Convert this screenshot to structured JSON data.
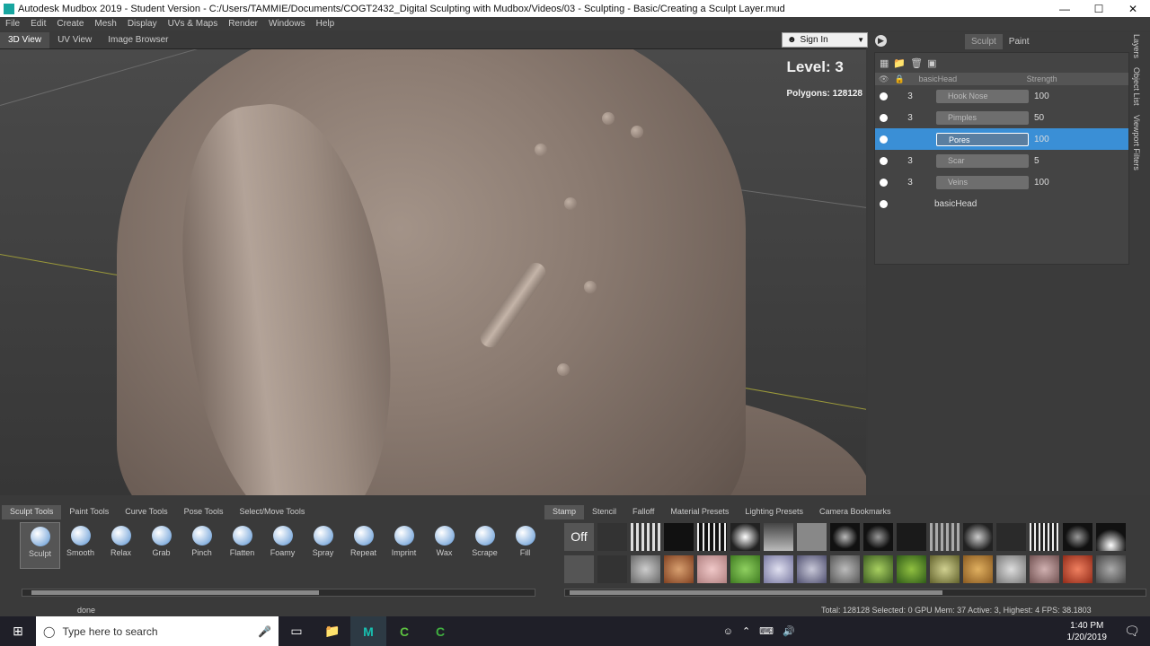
{
  "titlebar": {
    "title": "Autodesk Mudbox 2019 - Student Version - C:/Users/TAMMIE/Documents/COGT2432_Digital Sculpting with Mudbox/Videos/03 - Sculpting - Basic/Creating a Sculpt Layer.mud",
    "minimize": "—",
    "maximize": "☐",
    "close": "✕"
  },
  "menu": [
    "File",
    "Edit",
    "Create",
    "Mesh",
    "Display",
    "UVs & Maps",
    "Render",
    "Windows",
    "Help"
  ],
  "view_tabs": [
    "3D View",
    "UV View",
    "Image Browser"
  ],
  "viewport": {
    "level": "Level: 3",
    "polygons": "Polygons: 128128"
  },
  "signin": {
    "label": "Sign In"
  },
  "mode_tabs": [
    "Sculpt",
    "Paint"
  ],
  "layers": {
    "header_name": "basicHead",
    "header_strength": "Strength",
    "rows": [
      {
        "level": "3",
        "name": "Hook Nose",
        "strength": "100"
      },
      {
        "level": "3",
        "name": "Pimples",
        "strength": "50"
      },
      {
        "level": "",
        "name": "Pores",
        "strength": "100"
      },
      {
        "level": "3",
        "name": "Scar",
        "strength": "5"
      },
      {
        "level": "3",
        "name": "Veins",
        "strength": "100"
      }
    ],
    "mesh_name": "basicHead"
  },
  "side_tabs": [
    "Layers",
    "Object List",
    "Viewport Filters"
  ],
  "tool_tabs": [
    "Sculpt Tools",
    "Paint Tools",
    "Curve Tools",
    "Pose Tools",
    "Select/Move Tools"
  ],
  "tools": [
    "Sculpt",
    "Smooth",
    "Relax",
    "Grab",
    "Pinch",
    "Flatten",
    "Foamy",
    "Spray",
    "Repeat",
    "Imprint",
    "Wax",
    "Scrape",
    "Fill"
  ],
  "stamp_tabs": [
    "Stamp",
    "Stencil",
    "Falloff",
    "Material Presets",
    "Lighting Presets",
    "Camera Bookmarks"
  ],
  "stamp_off": "Off",
  "status": {
    "left": "done",
    "right": "Total: 128128  Selected: 0  GPU Mem: 37  Active: 3, Highest: 4  FPS: 38.1803"
  },
  "taskbar": {
    "search_placeholder": "Type here to search",
    "time": "1:40 PM",
    "date": "1/20/2019"
  }
}
